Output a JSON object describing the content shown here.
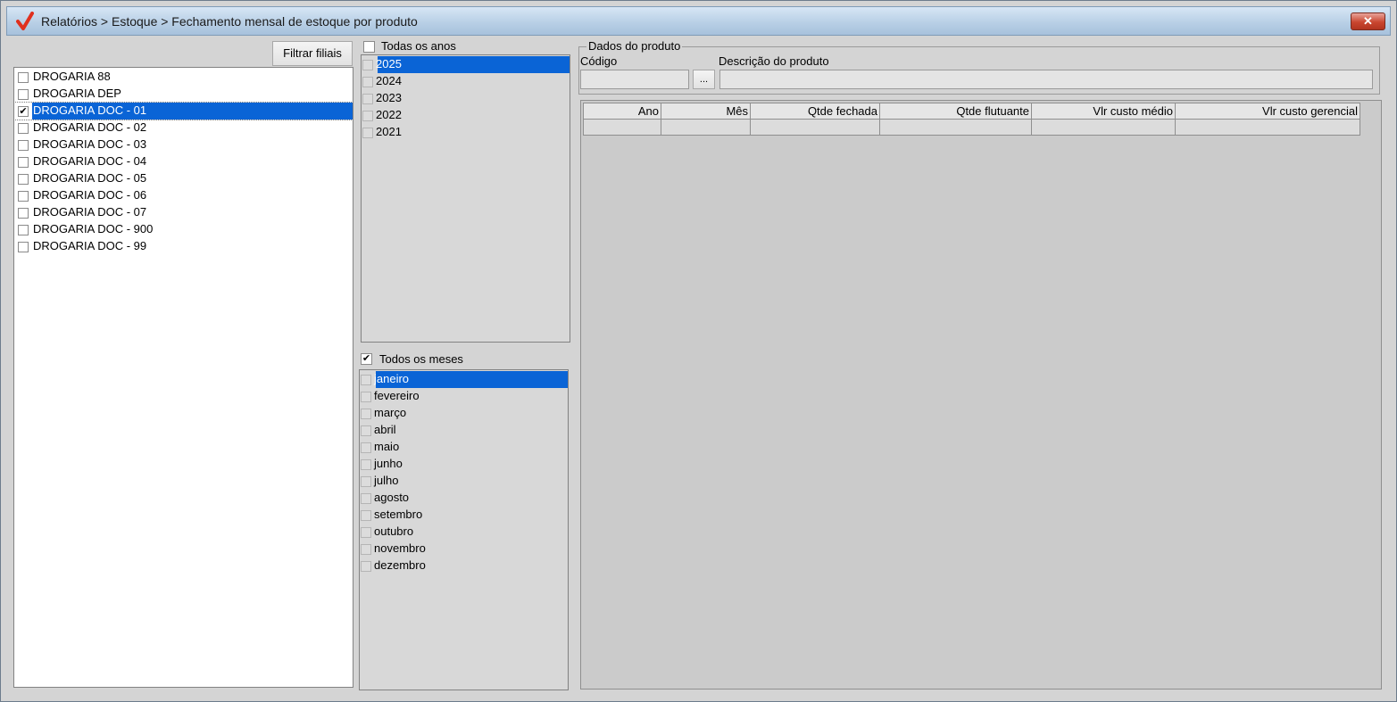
{
  "window": {
    "title": "Relatórios > Estoque > Fechamento mensal de estoque por produto",
    "close_symbol": "✕"
  },
  "branches": {
    "filter_button": "Filtrar filiais",
    "items": [
      {
        "label": "DROGARIA 88",
        "checked": false,
        "selected": false
      },
      {
        "label": "DROGARIA DEP",
        "checked": false,
        "selected": false
      },
      {
        "label": "DROGARIA DOC - 01",
        "checked": true,
        "selected": true
      },
      {
        "label": "DROGARIA DOC - 02",
        "checked": false,
        "selected": false
      },
      {
        "label": "DROGARIA DOC - 03",
        "checked": false,
        "selected": false
      },
      {
        "label": "DROGARIA DOC - 04",
        "checked": false,
        "selected": false
      },
      {
        "label": "DROGARIA DOC - 05",
        "checked": false,
        "selected": false
      },
      {
        "label": "DROGARIA DOC - 06",
        "checked": false,
        "selected": false
      },
      {
        "label": "DROGARIA DOC - 07",
        "checked": false,
        "selected": false
      },
      {
        "label": "DROGARIA DOC - 900",
        "checked": false,
        "selected": false
      },
      {
        "label": "DROGARIA DOC - 99",
        "checked": false,
        "selected": false
      }
    ]
  },
  "years": {
    "all_label": "Todas os anos",
    "all_checked": false,
    "items": [
      {
        "label": "2025",
        "selected": true
      },
      {
        "label": "2024",
        "selected": false
      },
      {
        "label": "2023",
        "selected": false
      },
      {
        "label": "2022",
        "selected": false
      },
      {
        "label": "2021",
        "selected": false
      }
    ]
  },
  "months": {
    "all_label": "Todos os meses",
    "all_checked": true,
    "items": [
      {
        "label": "janeiro",
        "selected": true
      },
      {
        "label": "fevereiro",
        "selected": false
      },
      {
        "label": "março",
        "selected": false
      },
      {
        "label": "abril",
        "selected": false
      },
      {
        "label": "maio",
        "selected": false
      },
      {
        "label": "junho",
        "selected": false
      },
      {
        "label": "julho",
        "selected": false
      },
      {
        "label": "agosto",
        "selected": false
      },
      {
        "label": "setembro",
        "selected": false
      },
      {
        "label": "outubro",
        "selected": false
      },
      {
        "label": "novembro",
        "selected": false
      },
      {
        "label": "dezembro",
        "selected": false
      }
    ]
  },
  "product": {
    "group_title": "Dados do produto",
    "code_label": "Código",
    "code_value": "",
    "lookup_button": "...",
    "description_label": "Descrição do produto",
    "description_value": ""
  },
  "grid": {
    "columns": [
      "Ano",
      "Mês",
      "Qtde fechada",
      "Qtde flutuante",
      "Vlr custo médio",
      "Vlr custo gerencial"
    ]
  },
  "colors": {
    "selection": "#0a64d6",
    "close_button": "#c9462f",
    "logo_check": "#e0301e"
  }
}
